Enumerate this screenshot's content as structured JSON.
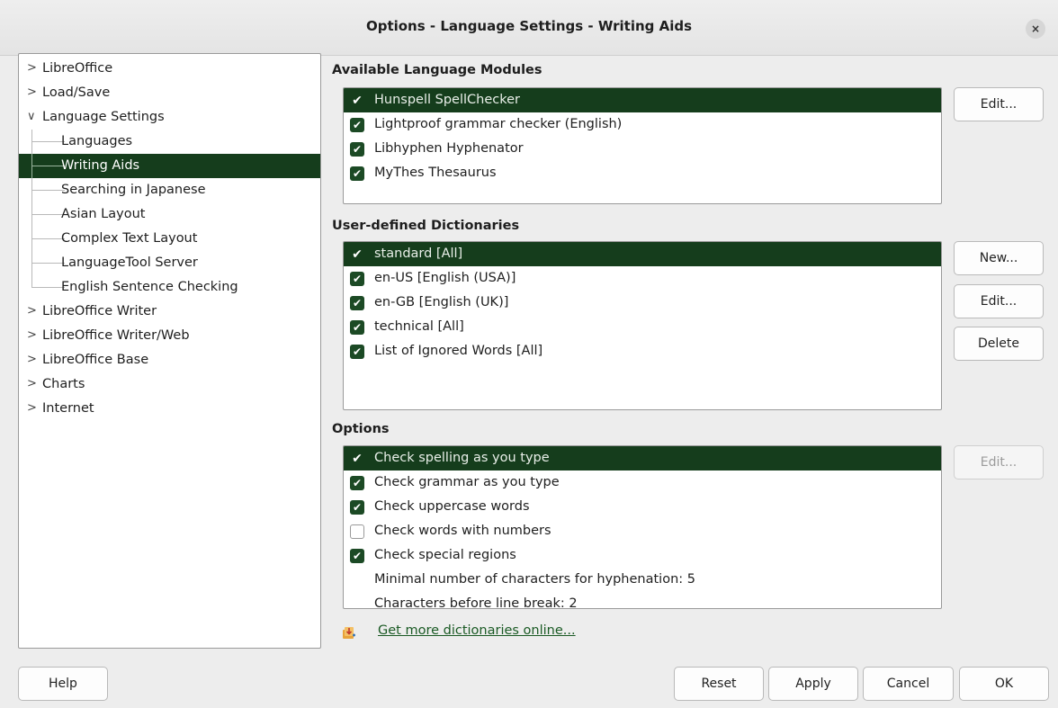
{
  "window": {
    "title": "Options - Language Settings - Writing Aids",
    "close_label": "×"
  },
  "tree": [
    {
      "label": "LibreOffice",
      "expander": ">"
    },
    {
      "label": "Load/Save",
      "expander": ">"
    },
    {
      "label": "Language Settings",
      "expander": "∨"
    },
    {
      "label": "Languages"
    },
    {
      "label": "Writing Aids"
    },
    {
      "label": "Searching in Japanese"
    },
    {
      "label": "Asian Layout"
    },
    {
      "label": "Complex Text Layout"
    },
    {
      "label": "LanguageTool Server"
    },
    {
      "label": "English Sentence Checking"
    },
    {
      "label": "LibreOffice Writer",
      "expander": ">"
    },
    {
      "label": "LibreOffice Writer/Web",
      "expander": ">"
    },
    {
      "label": "LibreOffice Base",
      "expander": ">"
    },
    {
      "label": "Charts",
      "expander": ">"
    },
    {
      "label": "Internet",
      "expander": ">"
    }
  ],
  "modules": {
    "title": "Available Language Modules",
    "items": [
      {
        "label": "Hunspell SpellChecker",
        "checked": true
      },
      {
        "label": "Lightproof grammar checker (English)",
        "checked": true
      },
      {
        "label": "Libhyphen Hyphenator",
        "checked": true
      },
      {
        "label": "MyThes Thesaurus",
        "checked": true
      }
    ],
    "edit_label": "Edit..."
  },
  "dictionaries": {
    "title": "User-defined Dictionaries",
    "items": [
      {
        "label": "standard [All]",
        "checked": true
      },
      {
        "label": "en-US [English (USA)]",
        "checked": true
      },
      {
        "label": "en-GB [English (UK)]",
        "checked": true
      },
      {
        "label": "technical [All]",
        "checked": true
      },
      {
        "label": "List of Ignored Words [All]",
        "checked": true
      }
    ],
    "new_label": "New...",
    "edit_label": "Edit...",
    "delete_label": "Delete"
  },
  "options": {
    "title": "Options",
    "items": [
      {
        "label": "Check spelling as you type",
        "checked": true
      },
      {
        "label": "Check grammar as you type",
        "checked": true
      },
      {
        "label": "Check uppercase words",
        "checked": true
      },
      {
        "label": "Check words with numbers",
        "checked": false
      },
      {
        "label": "Check special regions",
        "checked": true
      },
      {
        "label": "Minimal number of characters for hyphenation:  5"
      },
      {
        "label": "Characters before line break:  2"
      }
    ],
    "edit_label": "Edit..."
  },
  "more_dictionaries_link": "Get more dictionaries online...",
  "footer": {
    "help_label": "Help",
    "reset_label": "Reset",
    "apply_label": "Apply",
    "cancel_label": "Cancel",
    "ok_label": "OK"
  },
  "colors": {
    "selection": "#153d1c",
    "link": "#1a5a24",
    "checkbox": "#1c4a25"
  }
}
